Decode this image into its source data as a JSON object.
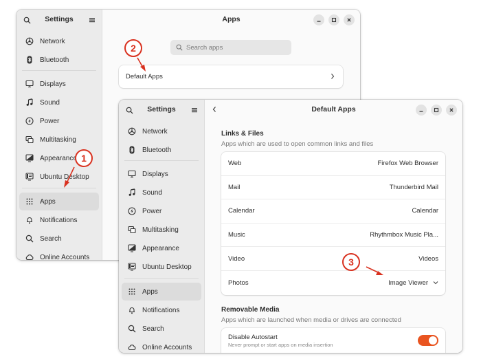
{
  "back_window": {
    "sidebar_title": "Settings",
    "title": "Apps",
    "search_placeholder": "Search apps",
    "default_apps_row": "Default Apps",
    "sidebar_items": [
      {
        "label": "Network",
        "icon": "network-icon"
      },
      {
        "label": "Bluetooth",
        "icon": "bluetooth-icon"
      },
      {
        "label": "Displays",
        "icon": "display-icon"
      },
      {
        "label": "Sound",
        "icon": "music-note-icon"
      },
      {
        "label": "Power",
        "icon": "power-icon"
      },
      {
        "label": "Multitasking",
        "icon": "multitasking-icon"
      },
      {
        "label": "Appearance",
        "icon": "appearance-icon"
      },
      {
        "label": "Ubuntu Desktop",
        "icon": "ubuntu-desktop-icon"
      },
      {
        "label": "Apps",
        "icon": "apps-grid-icon",
        "active": true
      },
      {
        "label": "Notifications",
        "icon": "bell-icon"
      },
      {
        "label": "Search",
        "icon": "search-icon"
      },
      {
        "label": "Online Accounts",
        "icon": "cloud-icon"
      }
    ]
  },
  "front_window": {
    "sidebar_title": "Settings",
    "title": "Default Apps",
    "sidebar_items": [
      {
        "label": "Network",
        "icon": "network-icon"
      },
      {
        "label": "Bluetooth",
        "icon": "bluetooth-icon"
      },
      {
        "label": "Displays",
        "icon": "display-icon"
      },
      {
        "label": "Sound",
        "icon": "music-note-icon"
      },
      {
        "label": "Power",
        "icon": "power-icon"
      },
      {
        "label": "Multitasking",
        "icon": "multitasking-icon"
      },
      {
        "label": "Appearance",
        "icon": "appearance-icon"
      },
      {
        "label": "Ubuntu Desktop",
        "icon": "ubuntu-desktop-icon"
      },
      {
        "label": "Apps",
        "icon": "apps-grid-icon",
        "active": true
      },
      {
        "label": "Notifications",
        "icon": "bell-icon"
      },
      {
        "label": "Search",
        "icon": "search-icon"
      },
      {
        "label": "Online Accounts",
        "icon": "cloud-icon"
      }
    ],
    "links_files": {
      "title": "Links & Files",
      "subtitle": "Apps which are used to open common links and files",
      "rows": [
        {
          "key": "Web",
          "value": "Firefox Web Browser"
        },
        {
          "key": "Mail",
          "value": "Thunderbird Mail"
        },
        {
          "key": "Calendar",
          "value": "Calendar"
        },
        {
          "key": "Music",
          "value": "Rhythmbox Music Pla..."
        },
        {
          "key": "Video",
          "value": "Videos"
        },
        {
          "key": "Photos",
          "value": "Image Viewer",
          "dropdown": true
        }
      ]
    },
    "removable_media": {
      "title": "Removable Media",
      "subtitle": "Apps which are launched when media or drives are connected",
      "autostart_label": "Disable Autostart",
      "autostart_sub": "Never prompt or start apps on media insertion",
      "autostart_on": true
    }
  },
  "callouts": [
    "1",
    "2",
    "3"
  ],
  "colors": {
    "accent": "#e95420",
    "callout": "#d9311f"
  }
}
